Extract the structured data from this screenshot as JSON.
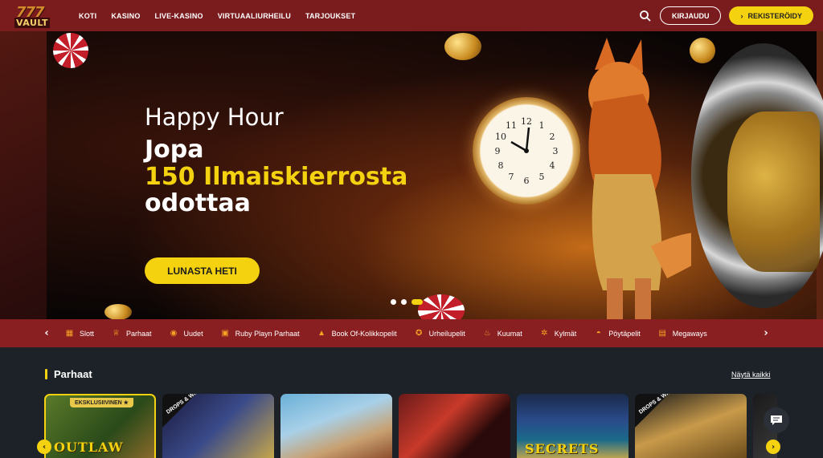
{
  "header": {
    "logo_top": "777",
    "logo_bottom": "VAULT",
    "nav": [
      "KOTI",
      "KASINO",
      "LIVE-KASINO",
      "VIRTUAALIURHEILU",
      "TARJOUKSET"
    ],
    "login_label": "KIRJAUDU",
    "register_label": "REKISTERÖIDY",
    "register_icon": "chevron-right-icon",
    "search_icon": "search-icon"
  },
  "hero": {
    "line1": "Happy Hour",
    "line2": "Jopa",
    "line3": "150 Ilmaiskierrosta",
    "line4": "odottaa",
    "cta_label": "LUNASTA HETI",
    "slide_count": 3,
    "active_slide": 3
  },
  "categories": [
    {
      "label": "Slott",
      "icon": "slot-icon"
    },
    {
      "label": "Parhaat",
      "icon": "trophy-icon"
    },
    {
      "label": "Uudet",
      "icon": "new-icon"
    },
    {
      "label": "Ruby Playn Parhaat",
      "icon": "ruby-icon"
    },
    {
      "label": "Book Of-Kolikkopelit",
      "icon": "book-icon"
    },
    {
      "label": "Urheilupelit",
      "icon": "ball-icon"
    },
    {
      "label": "Kuumat",
      "icon": "flame-icon"
    },
    {
      "label": "Kylmät",
      "icon": "snowflake-icon"
    },
    {
      "label": "Pöytäpelit",
      "icon": "table-icon"
    },
    {
      "label": "Megaways",
      "icon": "megaways-icon"
    }
  ],
  "section": {
    "title": "Parhaat",
    "see_all": "Näytä kaikki",
    "badges": {
      "exclusive": "EKSKLUSIIVINEN ★",
      "drops": "DROPS & WINS"
    },
    "card_texts": [
      "OUTLAW",
      "SECRETS"
    ]
  },
  "colors": {
    "header_bg": "#7a1c1e",
    "accent_yellow": "#f5d210",
    "catbar_bg": "#8a1f22",
    "page_bg": "#1c2228"
  }
}
